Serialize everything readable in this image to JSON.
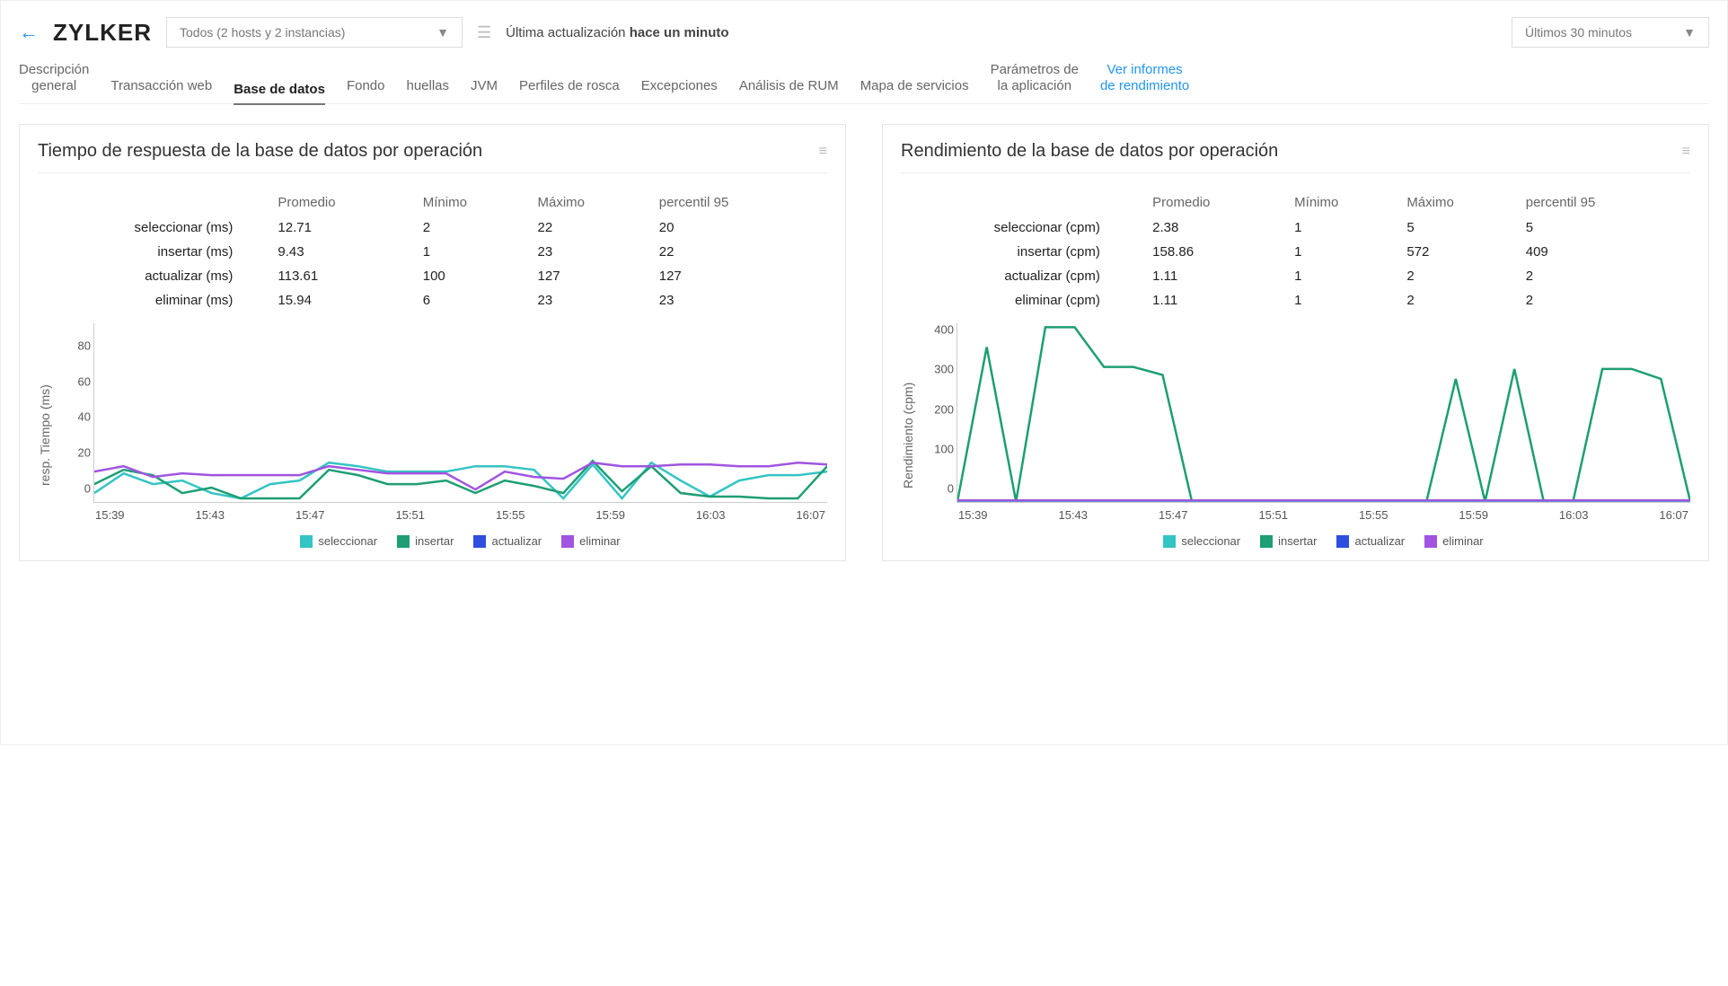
{
  "header": {
    "brand": "ZYLKER",
    "hostSelector": "Todos (2 hosts y 2 instancias)",
    "updatePrefix": "Última actualización ",
    "updateBold": "hace un minuto",
    "rangeSelector": "Últimos 30 minutos"
  },
  "tabs": [
    {
      "key": "overview",
      "label": "Descripción\ngeneral"
    },
    {
      "key": "webtx",
      "label": "Transacción web"
    },
    {
      "key": "db",
      "label": "Base de datos",
      "active": true
    },
    {
      "key": "bg",
      "label": "Fondo"
    },
    {
      "key": "traces",
      "label": "huellas"
    },
    {
      "key": "jvm",
      "label": "JVM"
    },
    {
      "key": "thread",
      "label": "Perfiles de rosca"
    },
    {
      "key": "exc",
      "label": "Excepciones"
    },
    {
      "key": "rum",
      "label": "Análisis de RUM"
    },
    {
      "key": "svcmap",
      "label": "Mapa de servicios"
    },
    {
      "key": "appparams",
      "label": "Parámetros de\nla aplicación"
    },
    {
      "key": "reports",
      "label": "Ver informes\nde rendimiento",
      "link": true
    }
  ],
  "columns": {
    "avg": "Promedio",
    "min": "Mínimo",
    "max": "Máximo",
    "p95": "percentil 95"
  },
  "ops": [
    {
      "key": "select",
      "label": "seleccionar",
      "color": "#35C4C4"
    },
    {
      "key": "insert",
      "label": "insertar",
      "color": "#1D9E74"
    },
    {
      "key": "update",
      "label": "actualizar",
      "color": "#2E4EE0"
    },
    {
      "key": "delete",
      "label": "eliminar",
      "color": "#A154E0"
    }
  ],
  "panelLeft": {
    "title": "Tiempo de respuesta de la base de datos por operación",
    "unit": "(ms)",
    "ylabel": "resp. Tiempo (ms)",
    "rows": {
      "select": {
        "avg": "12.71",
        "min": "2",
        "max": "22",
        "p95": "20"
      },
      "insert": {
        "avg": "9.43",
        "min": "1",
        "max": "23",
        "p95": "22"
      },
      "update": {
        "avg": "113.61",
        "min": "100",
        "max": "127",
        "p95": "127"
      },
      "delete": {
        "avg": "15.94",
        "min": "6",
        "max": "23",
        "p95": "23"
      }
    }
  },
  "panelRight": {
    "title": "Rendimiento de la base de datos por operación",
    "unit": "(cpm)",
    "ylabel": "Rendimiento (cpm)",
    "rows": {
      "select": {
        "avg": "2.38",
        "min": "1",
        "max": "5",
        "p95": "5"
      },
      "insert": {
        "avg": "158.86",
        "min": "1",
        "max": "572",
        "p95": "409"
      },
      "update": {
        "avg": "1.11",
        "min": "1",
        "max": "2",
        "p95": "2"
      },
      "delete": {
        "avg": "1.11",
        "min": "1",
        "max": "2",
        "p95": "2"
      }
    }
  },
  "chart_data": [
    {
      "type": "line",
      "title": "Tiempo de respuesta de la base de datos por operación",
      "xlabel": "",
      "ylabel": "resp. Tiempo (ms)",
      "categories": [
        "15:39",
        "15:43",
        "15:47",
        "15:51",
        "15:55",
        "15:59",
        "16:03",
        "16:07"
      ],
      "ylim": [
        0,
        100
      ],
      "yticks": [
        0,
        20,
        40,
        60,
        80
      ],
      "series": [
        {
          "name": "seleccionar",
          "color": "#35C4C4",
          "values": [
            5,
            16,
            10,
            12,
            5,
            2,
            10,
            12,
            22,
            20,
            17,
            17,
            17,
            20,
            20,
            18,
            2,
            21,
            2,
            22,
            12,
            3,
            12,
            15,
            15,
            17
          ]
        },
        {
          "name": "insertar",
          "color": "#1D9E74",
          "values": [
            10,
            18,
            15,
            5,
            8,
            2,
            2,
            2,
            18,
            15,
            10,
            10,
            12,
            5,
            12,
            9,
            5,
            23,
            6,
            20,
            5,
            3,
            3,
            2,
            2,
            20
          ]
        },
        {
          "name": "eliminar",
          "color": "#A154E0",
          "values": [
            17,
            20,
            14,
            16,
            15,
            15,
            15,
            15,
            20,
            18,
            16,
            16,
            16,
            7,
            17,
            14,
            13,
            22,
            20,
            20,
            21,
            21,
            20,
            20,
            22,
            21
          ]
        }
      ]
    },
    {
      "type": "line",
      "title": "Rendimiento de la base de datos por operación",
      "xlabel": "",
      "ylabel": "Rendimiento (cpm)",
      "categories": [
        "15:39",
        "15:43",
        "15:47",
        "15:51",
        "15:55",
        "15:59",
        "16:03",
        "16:07"
      ],
      "ylim": [
        0,
        450
      ],
      "yticks": [
        0,
        100,
        200,
        300,
        400
      ],
      "series": [
        {
          "name": "insertar",
          "color": "#1D9E74",
          "values": [
            1,
            390,
            1,
            440,
            440,
            340,
            340,
            320,
            1,
            1,
            1,
            1,
            1,
            1,
            1,
            1,
            1,
            310,
            1,
            335,
            1,
            1,
            335,
            335,
            310,
            1
          ]
        },
        {
          "name": "seleccionar",
          "color": "#35C4C4",
          "values": [
            2,
            2,
            2,
            2,
            2,
            2,
            2,
            2,
            2,
            2,
            2,
            2,
            2,
            2,
            2,
            2,
            2,
            2,
            2,
            2,
            2,
            2,
            2,
            2,
            2,
            2
          ]
        },
        {
          "name": "eliminar",
          "color": "#A154E0",
          "values": [
            4,
            4,
            4,
            4,
            4,
            4,
            4,
            4,
            4,
            4,
            4,
            4,
            4,
            4,
            4,
            4,
            4,
            4,
            4,
            4,
            4,
            4,
            4,
            4,
            4,
            4
          ]
        }
      ]
    }
  ]
}
